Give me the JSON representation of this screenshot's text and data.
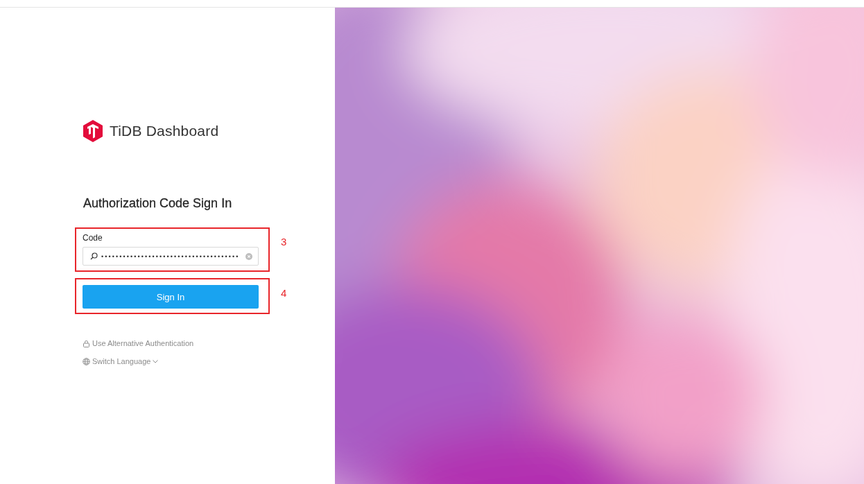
{
  "brand": {
    "name": "TiDB Dashboard"
  },
  "heading": "Authorization Code Sign In",
  "code_field": {
    "label": "Code",
    "value": "••••••••••••••••••••••••••••••••••••••",
    "clearable": true
  },
  "sign_in_button": "Sign In",
  "annotations": [
    {
      "label": "3"
    },
    {
      "label": "4"
    }
  ],
  "links": [
    {
      "kind": "lock",
      "label": "Use Alternative Authentication"
    },
    {
      "kind": "language",
      "label": "Switch Language"
    }
  ]
}
